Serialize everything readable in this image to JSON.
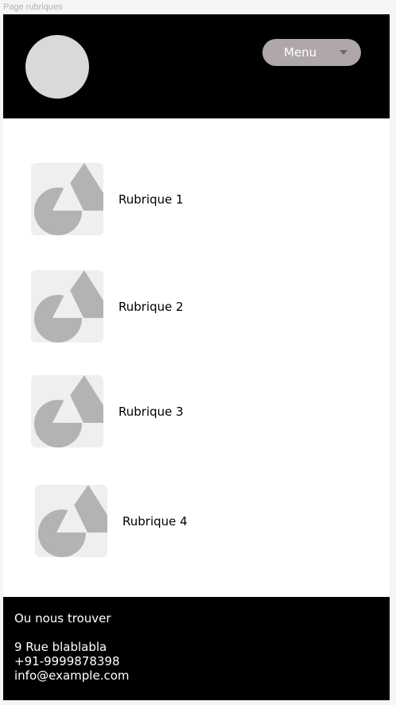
{
  "frame": {
    "label": "Page rubriques"
  },
  "header": {
    "logo_icon": "logo-circle",
    "menu": {
      "label": "Menu",
      "icon": "caret-down-icon"
    }
  },
  "rubriques": [
    {
      "label": "Rubrique 1",
      "icon": "image-placeholder-icon"
    },
    {
      "label": "Rubrique 2",
      "icon": "image-placeholder-icon"
    },
    {
      "label": "Rubrique 3",
      "icon": "image-placeholder-icon"
    },
    {
      "label": "Rubrique 4",
      "icon": "image-placeholder-icon"
    }
  ],
  "footer": {
    "title": "Ou nous trouver",
    "address": "9 Rue blablabla",
    "phone": "+91-9999878398",
    "email": "info@example.com"
  },
  "colors": {
    "header_bg": "#000000",
    "menu_bg": "#b0a8a8",
    "placeholder_shape": "#b3b3b3",
    "placeholder_bg": "#efefef"
  }
}
